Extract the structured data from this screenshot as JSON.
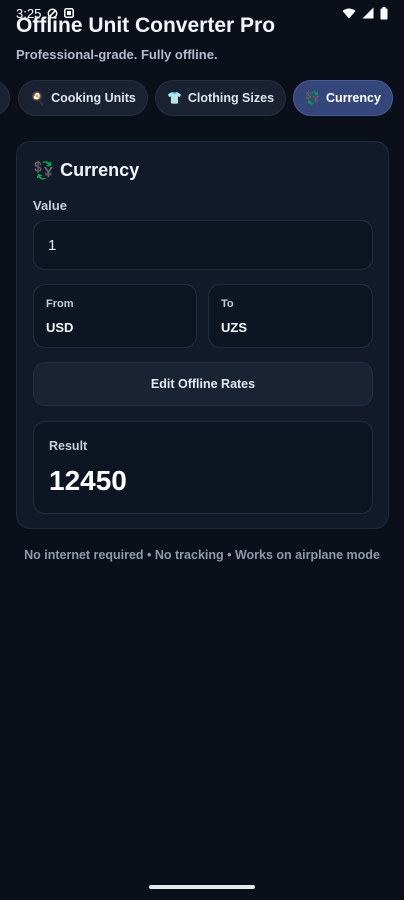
{
  "status_bar": {
    "time": "3:25",
    "icons": [
      "dnd-icon",
      "notification-icon",
      "wifi-icon",
      "signal-icon",
      "battery-icon"
    ]
  },
  "header": {
    "title": "Offline Unit Converter Pro",
    "subtitle": "Professional-grade. Fully offline."
  },
  "tabs": [
    {
      "label": "",
      "icon": "partial-tab-icon",
      "active": false
    },
    {
      "label": "Cooking Units",
      "icon": "cooking-icon",
      "glyph": "🍳",
      "active": false
    },
    {
      "label": "Clothing Sizes",
      "icon": "shirt-icon",
      "glyph": "👕",
      "active": false
    },
    {
      "label": "Currency",
      "icon": "currency-exchange-icon",
      "glyph": "💱",
      "active": true
    }
  ],
  "converter": {
    "icon": "currency-exchange-icon",
    "glyph": "💱",
    "title": "Currency",
    "value_label": "Value",
    "value": "1",
    "from_label": "From",
    "from_value": "USD",
    "to_label": "To",
    "to_value": "UZS",
    "edit_rates_label": "Edit Offline Rates",
    "result_label": "Result",
    "result_value": "12450"
  },
  "footer": {
    "note": "No internet required • No tracking • Works on airplane mode"
  },
  "colors": {
    "background": "#0b0f1a",
    "card": "#121a2a",
    "active_tab": "#35477a",
    "accent_green": "#3fbf6a"
  }
}
